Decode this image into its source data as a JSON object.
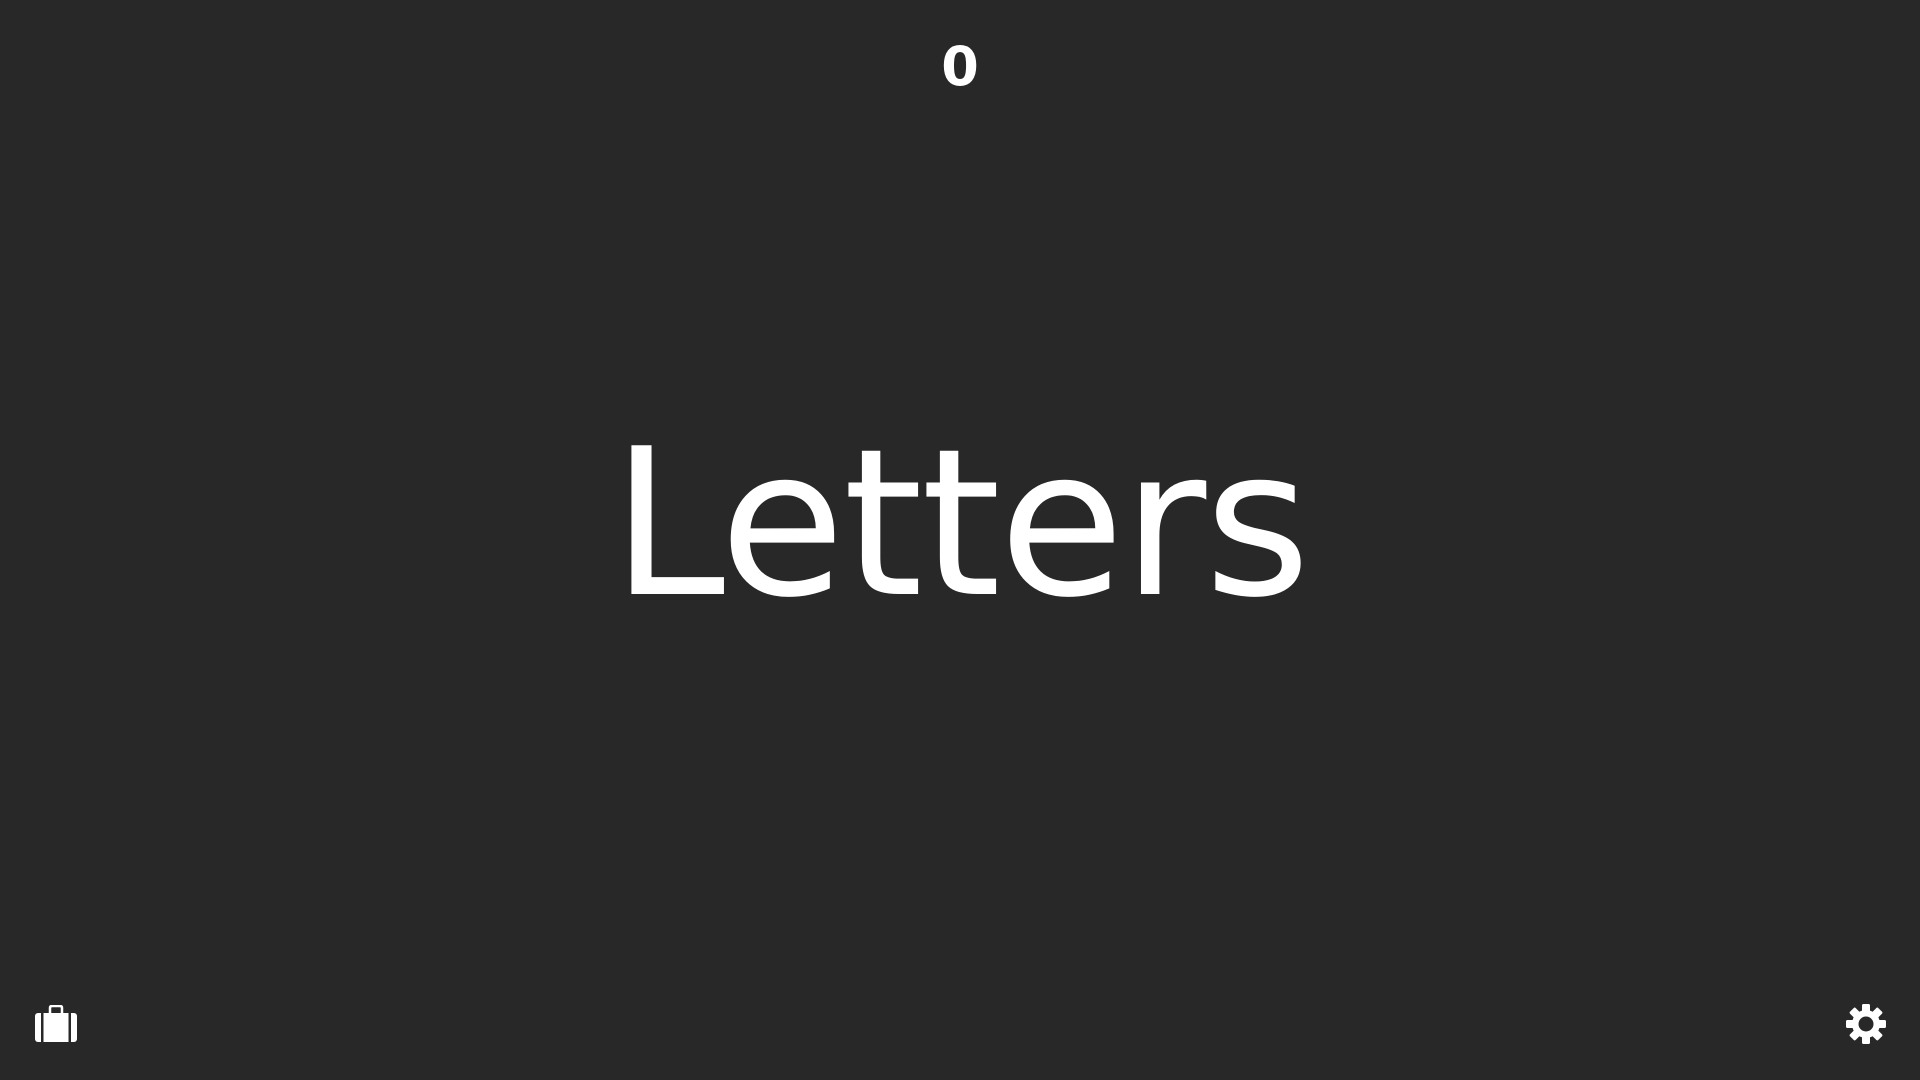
{
  "game": {
    "score": "0",
    "title": "Letters"
  },
  "controls": {
    "left_icon": "briefcase-icon",
    "right_icon": "gear-icon"
  },
  "colors": {
    "background": "#282828",
    "foreground": "#ffffff"
  }
}
